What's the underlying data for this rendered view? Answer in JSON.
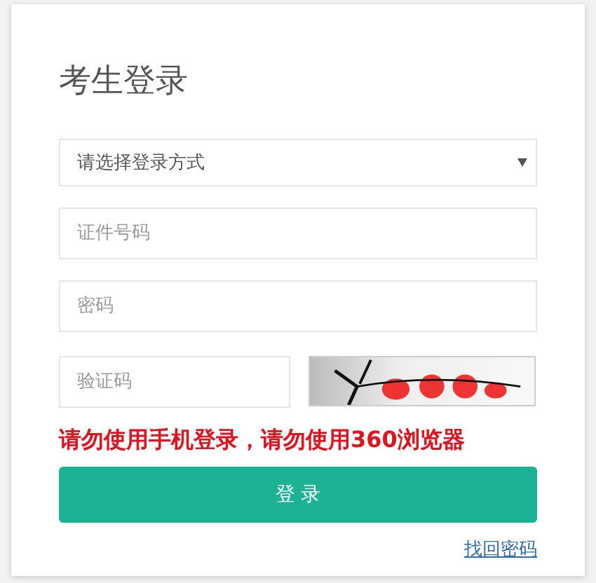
{
  "title": "考生登录",
  "login_method": {
    "placeholder": "请选择登录方式"
  },
  "id_number": {
    "placeholder": "证件号码"
  },
  "password": {
    "placeholder": "密码"
  },
  "captcha": {
    "placeholder": "验证码"
  },
  "warning": "请勿使用手机登录，请勿使用360浏览器",
  "login_button": "登 录",
  "forgot_link": "找回密码"
}
